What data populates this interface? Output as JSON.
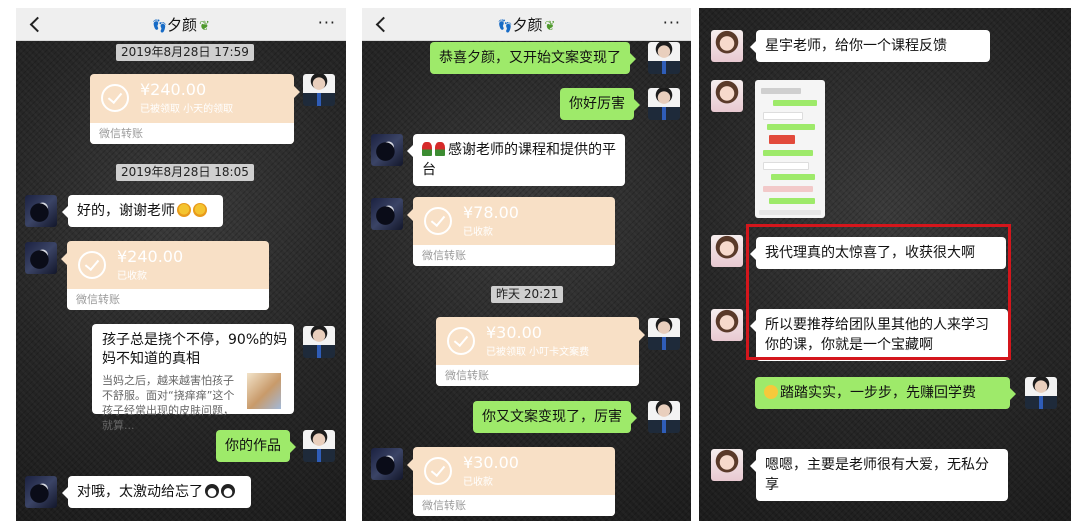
{
  "panels": [
    {
      "title": "夕颜",
      "more": "···",
      "timestamp1": "2019年8月28日 17:59",
      "timestamp2": "2019年8月28日 18:05",
      "transfer1": {
        "amount": "¥240.00",
        "status": "已被领取 小天的领取",
        "label": "微信转账"
      },
      "msg1": "好的，谢谢老师",
      "transfer2": {
        "amount": "¥240.00",
        "status": "已收款",
        "label": "微信转账"
      },
      "card": {
        "title": "孩子总是挠个不停，90%的妈妈不知道的真相",
        "desc": "当妈之后，越来越害怕孩子不舒服。面对“挠痒痒”这个孩子经常出现的皮肤问题，就算..."
      },
      "msg2": "你的作品",
      "msg3": "对哦，太激动给忘了"
    },
    {
      "title": "夕颜",
      "more": "···",
      "msg1": "恭喜夕颜，又开始文案变现了",
      "msg2": "你好厉害",
      "msg3": "感谢老师的课程和提供的平台",
      "transfer1": {
        "amount": "¥78.00",
        "status": "已收款",
        "label": "微信转账"
      },
      "timestamp1": "昨天 20:21",
      "transfer2": {
        "amount": "¥30.00",
        "status": "已被领取 小叮卡文案费",
        "label": "微信转账"
      },
      "msg4": "你又文案变现了，厉害",
      "transfer3": {
        "amount": "¥30.00",
        "status": "已收款",
        "label": "微信转账"
      }
    },
    {
      "msg1": "星宇老师，给你一个课程反馈",
      "msg2": "我代理真的太惊喜了，收获很大啊",
      "msg3": "所以要推荐给团队里其他的人来学习你的课，你就是一个宝藏啊",
      "msg4": "踏踏实实，一步步，先赚回学费",
      "msg5": "嗯嗯，主要是老师很有大爱，无私分享"
    }
  ],
  "colors": {
    "green_bubble": "#9eea6a",
    "transfer": "#f8e0c6",
    "highlight": "#d4161c"
  }
}
